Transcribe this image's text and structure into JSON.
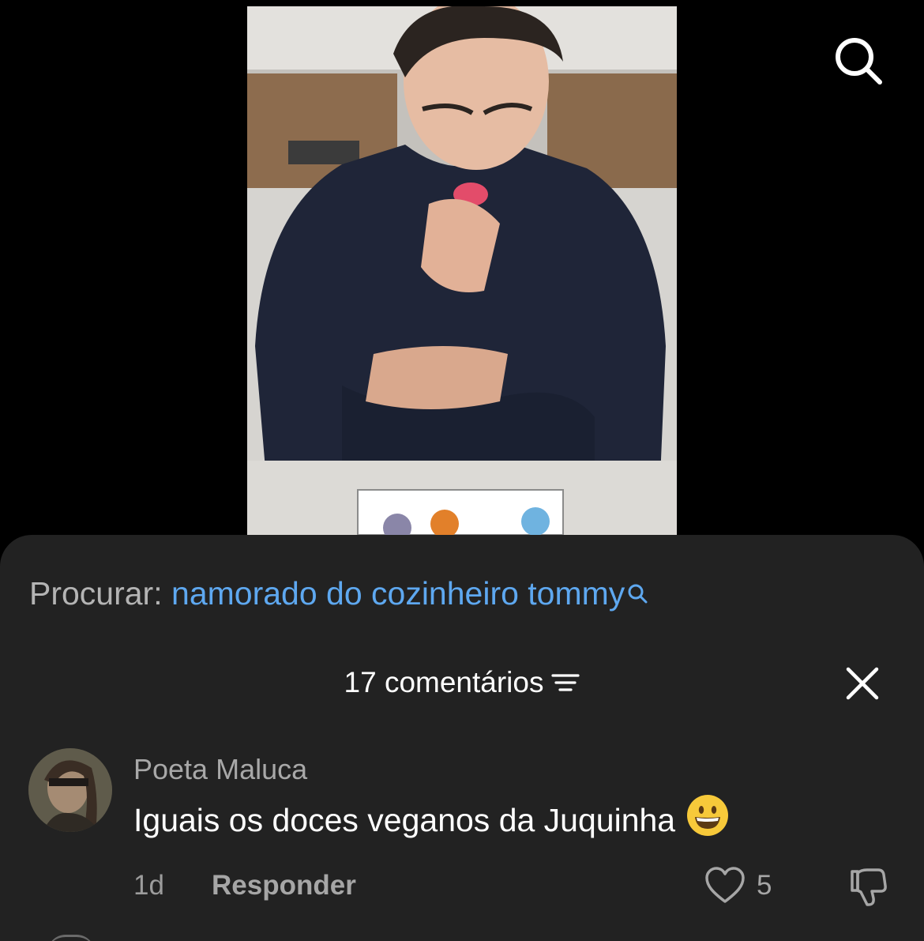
{
  "video": {
    "icon": "video-thumbnail"
  },
  "top_bar": {
    "search_icon": "search-icon"
  },
  "sheet": {
    "search_suggestion": {
      "label": "Procurar:",
      "query": "namorado do cozinheiro tommy",
      "icon": "search-icon"
    },
    "header": {
      "count_label": "17 comentários",
      "filter_icon": "filter-icon",
      "close_icon": "close-icon"
    },
    "comments": [
      {
        "username": "Poeta Maluca",
        "text": "Iguais os doces veganos da Juquinha",
        "emoji": "grinning-face-emoji",
        "time": "1d",
        "reply_label": "Responder",
        "likes": "5",
        "like_icon": "heart-icon",
        "dislike_icon": "thumbs-down-icon"
      }
    ]
  },
  "colors": {
    "background": "#000000",
    "sheet": "#222222",
    "link": "#5ea8f0",
    "muted": "#a8a8a8"
  }
}
